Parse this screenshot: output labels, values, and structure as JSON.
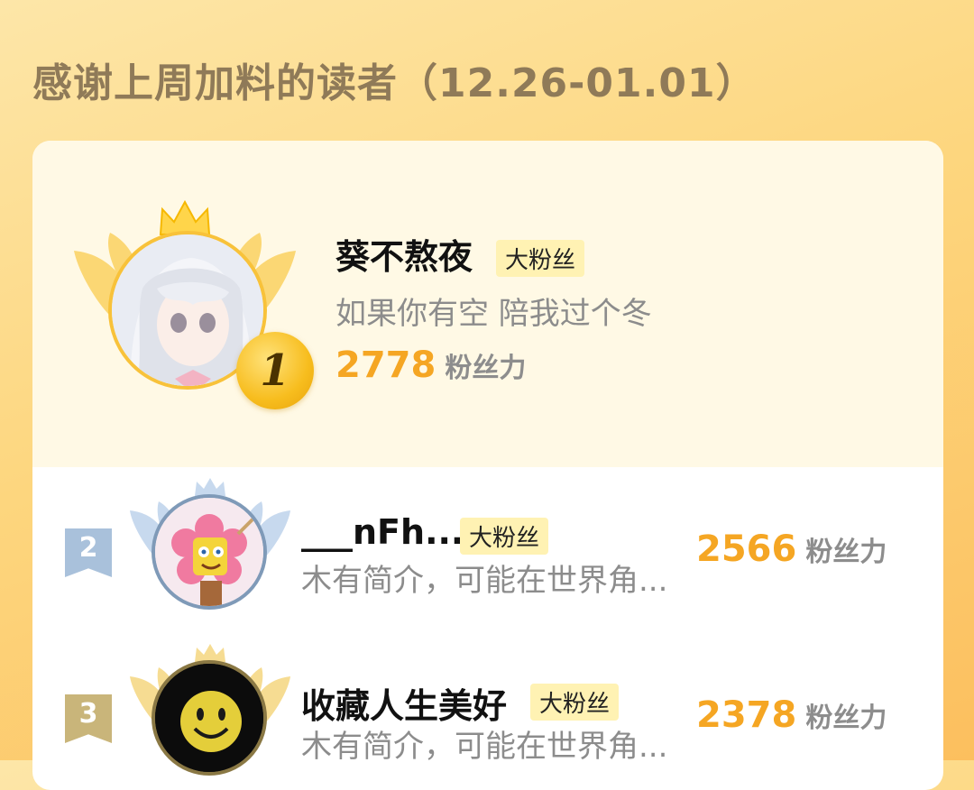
{
  "header": {
    "title": "感谢上周加料的读者（12.26-01.01）"
  },
  "leaderboard": [
    {
      "rank": "1",
      "name": "葵不熬夜",
      "badge": "大粉丝",
      "bio": "如果你有空 陪我过个冬",
      "score": "2778",
      "score_unit": "粉丝力"
    },
    {
      "rank": "2",
      "name": "___nFh...",
      "badge": "大粉丝",
      "bio": "木有简介，可能在世界角...",
      "score": "2566",
      "score_unit": "粉丝力"
    },
    {
      "rank": "3",
      "name": "收藏人生美好",
      "badge": "大粉丝",
      "bio": "木有简介，可能在世界角...",
      "score": "2378",
      "score_unit": "粉丝力"
    }
  ],
  "colors": {
    "accent": "#f5a623",
    "gold_medal": "#f7bd1e",
    "silver_flag": "#a9c1db",
    "bronze_flag": "#c9b57a"
  },
  "icons": {
    "crown": "crown-icon",
    "wings": "wings-icon",
    "rank_flag": "rank-flag-icon"
  }
}
